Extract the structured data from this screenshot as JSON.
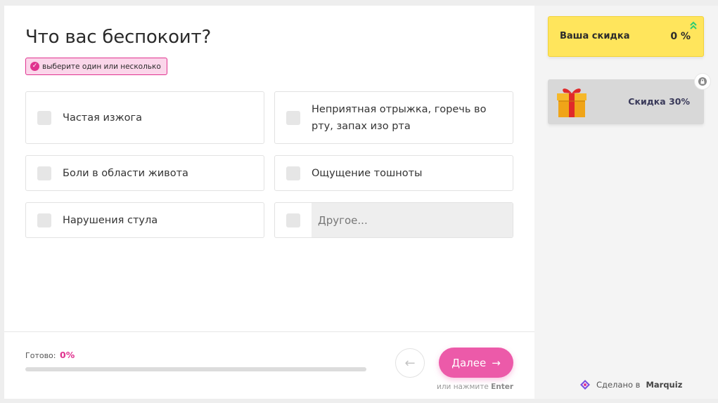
{
  "question": {
    "title": "Что вас беспокоит?",
    "hint": "выберите один или несколько"
  },
  "options": [
    {
      "label": "Частая изжога"
    },
    {
      "label": "Неприятная отрыжка, горечь во рту, запах изо рта"
    },
    {
      "label": "Боли в области живота"
    },
    {
      "label": "Ощущение тошноты"
    },
    {
      "label": "Нарушения стула"
    }
  ],
  "other": {
    "placeholder": "Другое..."
  },
  "progress": {
    "label": "Готово:",
    "value_text": "0%",
    "value": 0
  },
  "navigation": {
    "next_label": "Далее",
    "enter_hint_prefix": "или нажмите",
    "enter_hint_key": "Enter"
  },
  "sidebar": {
    "discount_label": "Ваша скидка",
    "discount_value": "0 %",
    "gift_label": "Скидка 30%"
  },
  "credit": {
    "prefix": "Сделано в",
    "brand": "Marquiz"
  },
  "colors": {
    "accent": "#e0338f",
    "button": "#ec5aa9",
    "discount_bg": "#ffe55c",
    "arrow_green": "#2ecc71"
  }
}
